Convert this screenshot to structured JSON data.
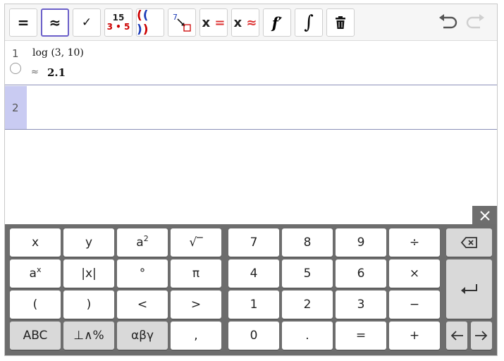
{
  "toolbar": {
    "equals": "=",
    "approx": "≈",
    "check": "✓",
    "frac_top": "15",
    "frac_bottom": "3 • 5",
    "parens_outer_open": "(",
    "parens_inner": "( )",
    "parens_outer_close": ")",
    "substitute_num": "7",
    "x_equals_x": "x",
    "x_equals_eq": "=",
    "x_approx_x": "x",
    "x_approx_eq": "≈",
    "derivative": "f′",
    "integral": "∫",
    "active_tool": "approx"
  },
  "rows": [
    {
      "index": "1",
      "input": "log (3, 10)",
      "output_symbol": "≈",
      "output": "2.1"
    },
    {
      "index": "2",
      "input": ""
    }
  ],
  "keyboard": {
    "left": [
      [
        "x",
        "y",
        "a²",
        "√‾"
      ],
      [
        "aˣ",
        "|x|",
        "°",
        "π"
      ],
      [
        "(",
        ")",
        "<",
        ">"
      ],
      [
        "ABC",
        "⊥∧%",
        "αβγ",
        ","
      ]
    ],
    "numpad": [
      [
        "7",
        "8",
        "9",
        "÷"
      ],
      [
        "4",
        "5",
        "6",
        "×"
      ],
      [
        "1",
        "2",
        "3",
        "−"
      ],
      [
        "0",
        ".",
        "=",
        "+"
      ]
    ],
    "labels": {
      "a2_base": "a",
      "a2_exp": "2",
      "ax_base": "a",
      "ax_exp": "x",
      "sqrt": "√‾"
    }
  },
  "colors": {
    "accent": "#6b5fc9",
    "row_highlight": "#c9cbf2",
    "keyboard_bg": "#6d6d6d",
    "red": "#cc0000",
    "blue": "#1c3bb8"
  }
}
